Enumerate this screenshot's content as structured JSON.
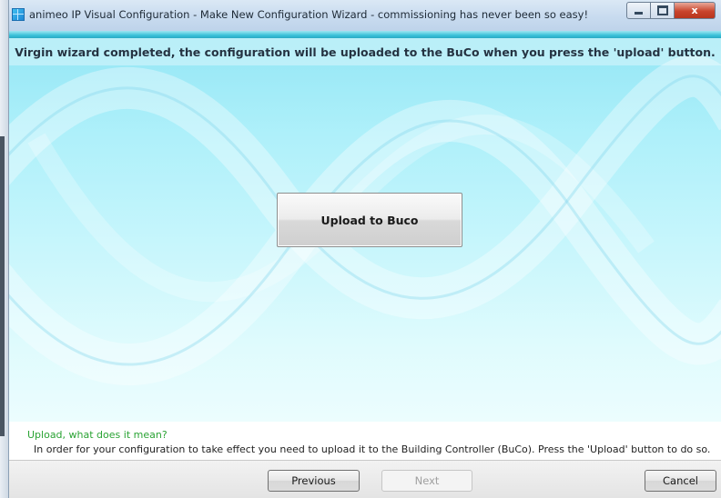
{
  "window": {
    "title": "animeo IP Visual Configuration - Make New Configuration Wizard - commissioning has never been so easy!",
    "controls": {
      "minimize_icon": "minimize-icon",
      "maximize_icon": "maximize-icon",
      "close_label": "x"
    }
  },
  "header": {
    "message": "Virgin wizard completed, the configuration will be uploaded to the BuCo when you press the 'upload' button."
  },
  "main": {
    "upload_button_label": "Upload to Buco"
  },
  "help": {
    "title": "Upload, what does it mean?",
    "text": "In order for your configuration to take effect you need to upload it to the Building Controller (BuCo). Press the 'Upload' button to do so."
  },
  "footer": {
    "previous_label": "Previous",
    "next_label": "Next",
    "cancel_label": "Cancel"
  },
  "colors": {
    "accent": "#3bc2d9",
    "help_title": "#2aa334",
    "background_top": "#94e6f5",
    "background_bottom": "#ecfdfe"
  }
}
